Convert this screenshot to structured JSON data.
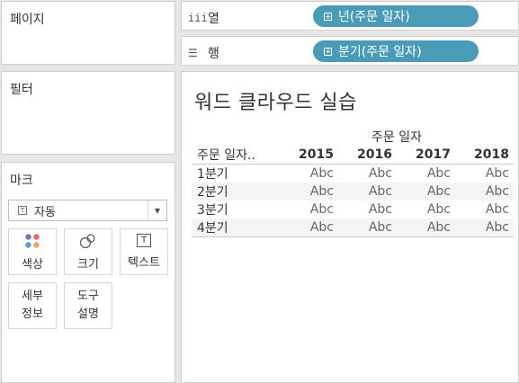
{
  "pages": {
    "title": "페이지"
  },
  "filters": {
    "title": "필터"
  },
  "marks": {
    "title": "마크",
    "type_icon": "T",
    "type_value": "자동",
    "buttons": [
      {
        "name": "color",
        "label": "색상"
      },
      {
        "name": "size",
        "label": "크기"
      },
      {
        "name": "text",
        "label": "텍스트",
        "icon": "T"
      },
      {
        "name": "detail",
        "line1": "세부",
        "line2": "정보"
      },
      {
        "name": "tooltip",
        "line1": "도구",
        "line2": "설명"
      }
    ]
  },
  "shelves": {
    "columns": {
      "icon": "iii",
      "label": "열",
      "pill": "년(주문 일자)"
    },
    "rows": {
      "icon": "☰",
      "label": "행",
      "pill": "분기(주문 일자)"
    }
  },
  "view": {
    "title": "워드 클라우드 실습",
    "column_group_header": "주문 일자",
    "row_header": "주문 일자..",
    "years": [
      "2015",
      "2016",
      "2017",
      "2018"
    ],
    "rows": [
      {
        "label": "1분기",
        "cells": [
          "Abc",
          "Abc",
          "Abc",
          "Abc"
        ]
      },
      {
        "label": "2분기",
        "cells": [
          "Abc",
          "Abc",
          "Abc",
          "Abc"
        ]
      },
      {
        "label": "3분기",
        "cells": [
          "Abc",
          "Abc",
          "Abc",
          "Abc"
        ]
      },
      {
        "label": "4분기",
        "cells": [
          "Abc",
          "Abc",
          "Abc",
          "Abc"
        ]
      }
    ]
  }
}
